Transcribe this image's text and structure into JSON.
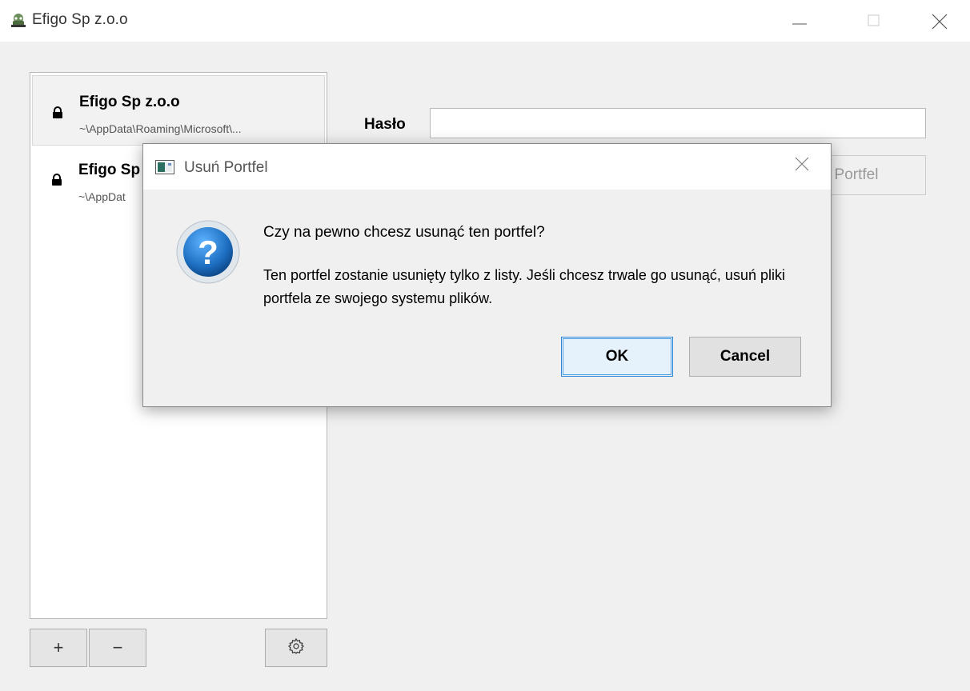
{
  "window": {
    "title": "Efigo Sp z.o.o",
    "controls": [
      "minimize-icon",
      "maximize-icon",
      "close-icon"
    ]
  },
  "wallet_list": {
    "items": [
      {
        "name": "Efigo Sp z.o.o",
        "path": "~\\AppData\\Roaming\\Microsoft\\...",
        "icon": "lock-icon",
        "selected": true
      },
      {
        "name": "Efigo Sp",
        "path": "~\\AppDat",
        "icon": "lock-icon",
        "selected": false
      }
    ],
    "buttons": {
      "add": "+",
      "remove": "−",
      "settings_icon": "gear-icon"
    }
  },
  "form": {
    "password_label": "Hasło",
    "password_value": "",
    "open_button_label": "Portfel"
  },
  "dialog": {
    "title": "Usuń Portfel",
    "icon": "question-icon",
    "heading": "Czy na pewno chcesz usunąć ten portfel?",
    "body": "Ten portfel zostanie usunięty tylko z listy. Jeśli chcesz trwale go usunąć, usuń pliki portfela ze swojego systemu plików.",
    "ok_label": "OK",
    "cancel_label": "Cancel"
  },
  "colors": {
    "window_bg": "#f0f0f0",
    "accent_focus": "#2b86d8",
    "question_blue": "#1e6fc2"
  }
}
